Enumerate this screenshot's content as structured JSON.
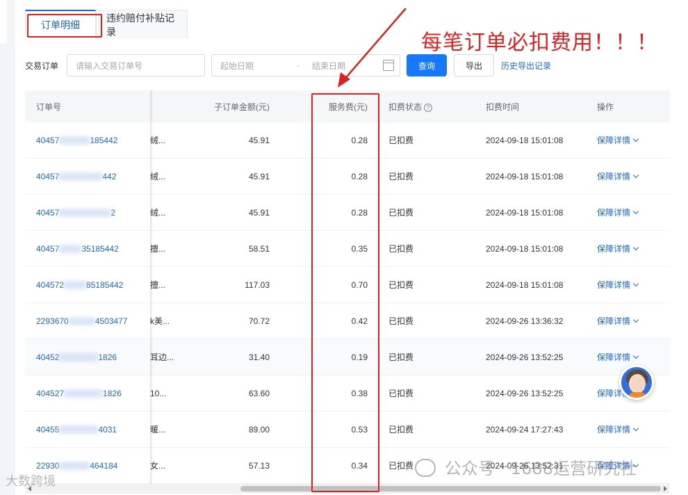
{
  "tabs": [
    {
      "label": "订单明细",
      "active": true
    },
    {
      "label": "违约赔付补贴记录",
      "active": false
    }
  ],
  "filters": {
    "label": "交易订单",
    "order_placeholder": "请输入交易订单号",
    "start_placeholder": "起始日期",
    "separator": "-",
    "end_placeholder": "结束日期",
    "query_label": "查询",
    "export_label": "导出",
    "history_label": "历史导出记录"
  },
  "table": {
    "headers": {
      "order": "订单号",
      "amount": "子订单金额(元)",
      "fee": "服务费(元)",
      "status": "扣费状态",
      "time": "扣费时间",
      "op": "操作"
    },
    "rows": [
      {
        "order_prefix": "40457",
        "order_suffix": "185442",
        "product": "绒...",
        "amount": "45.91",
        "fee": "0.28",
        "status": "已扣费",
        "time": "2024-09-18 15:01:08",
        "op": "保障详情"
      },
      {
        "order_prefix": "40457",
        "order_suffix": "442",
        "product": "绒...",
        "amount": "45.91",
        "fee": "0.28",
        "status": "已扣费",
        "time": "2024-09-18 15:01:08",
        "op": "保障详情"
      },
      {
        "order_prefix": "40457",
        "order_suffix": "2",
        "product": "绒...",
        "amount": "45.91",
        "fee": "0.28",
        "status": "已扣费",
        "time": "2024-09-18 15:01:08",
        "op": "保障详情"
      },
      {
        "order_prefix": "40457",
        "order_suffix": "35185442",
        "product": "擅...",
        "amount": "58.51",
        "fee": "0.35",
        "status": "已扣费",
        "time": "2024-09-18 15:01:08",
        "op": "保障详情"
      },
      {
        "order_prefix": "404572",
        "order_suffix": "85185442",
        "product": "擅...",
        "amount": "117.03",
        "fee": "0.70",
        "status": "已扣费",
        "time": "2024-09-18 15:01:08",
        "op": "保障详情"
      },
      {
        "order_prefix": "2293670",
        "order_suffix": "4503477",
        "product": "k美...",
        "amount": "70.72",
        "fee": "0.42",
        "status": "已扣费",
        "time": "2024-09-26 13:36:32",
        "op": "保障详情"
      },
      {
        "order_prefix": "40452",
        "order_suffix": "1826",
        "product": "耳边...",
        "amount": "31.40",
        "fee": "0.19",
        "status": "已扣费",
        "time": "2024-09-26 13:52:25",
        "op": "保障详情"
      },
      {
        "order_prefix": "404527",
        "order_suffix": "1826",
        "product": "10...",
        "amount": "63.60",
        "fee": "0.38",
        "status": "已扣费",
        "time": "2024-09-26 13:52:25",
        "op": "保障详情"
      },
      {
        "order_prefix": "40455",
        "order_suffix": "4031",
        "product": "暖...",
        "amount": "89.00",
        "fee": "0.53",
        "status": "已扣费",
        "time": "2024-09-24 17:27:43",
        "op": "保障详情"
      },
      {
        "order_prefix": "22930",
        "order_suffix": "464184",
        "product": "女...",
        "amount": "57.13",
        "fee": "0.34",
        "status": "已扣费",
        "time": "2024-09-26 13:52:31",
        "op": "保障详情"
      }
    ]
  },
  "annotation": {
    "callout": "每笔订单必扣费用！！！",
    "color": "#e02020"
  },
  "watermarks": {
    "right": "公众号 · 1688运营研究社",
    "left": "大数跨境"
  },
  "colors": {
    "link": "#1a66d6",
    "primary": "#1677ff"
  }
}
